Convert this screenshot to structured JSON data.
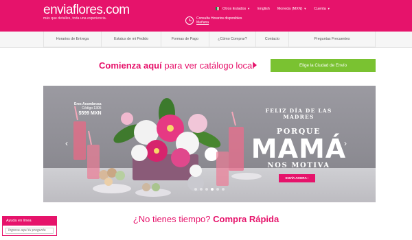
{
  "brand": {
    "logo": "enviaflores.com",
    "tagline": "más que detalles, toda una experiencia."
  },
  "topnav": {
    "country": "Otros Estados",
    "language": "English",
    "currency": "Moneda (MXN)",
    "account": "Cuenta"
  },
  "schedule": {
    "line1": "Consulta Horarios disponibles",
    "line2": "Mañana"
  },
  "subnav": [
    "Horarios de Entrega",
    "Estatus de mi Pedido",
    "Formas de Pago",
    "¿Cómo Comprar?",
    "Contacto",
    "Preguntas Frecuentes"
  ],
  "catalog": {
    "lead": "Comienza aquí",
    "rest": " para ver catálogo local",
    "button": "Elige la Ciudad de Envío"
  },
  "hero": {
    "product_name": "Eres Asombrosa",
    "product_code": "Código 1305",
    "product_price": "$599 MXN",
    "line1": "FELIZ DÍA DE LAS MADRES",
    "line2": "PORQUE",
    "line3": "MAMÁ",
    "line4": "NOS MOTIVA",
    "cta": "ENVÍA AHORA ›",
    "slides": 6,
    "active_slide": 3
  },
  "quick": {
    "lead": "¿No tienes tiempo?",
    "rest": " Compra Rápida"
  },
  "help": {
    "title": "Ayuda en línea",
    "placeholder": "Ingresa aquí tu pregunta"
  },
  "colors": {
    "brand_pink": "#e6136b",
    "button_green": "#7ac231"
  }
}
